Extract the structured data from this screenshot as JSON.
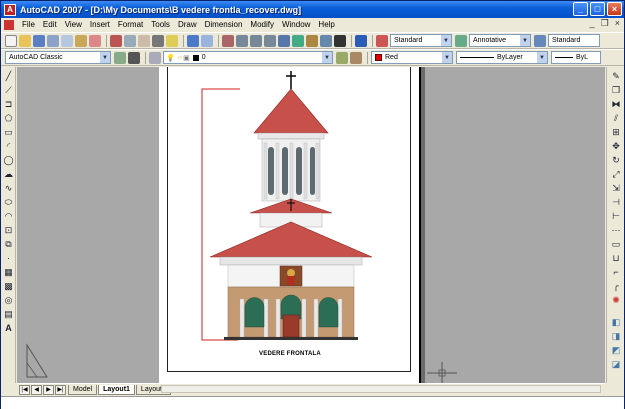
{
  "window": {
    "title": "AutoCAD 2007 - [D:\\My Documents\\B vedere frontla_recover.dwg]",
    "buttons": {
      "minimize": "_",
      "maximize": "□",
      "close": "×"
    }
  },
  "menu": {
    "items": [
      "File",
      "Edit",
      "View",
      "Insert",
      "Format",
      "Tools",
      "Draw",
      "Dimension",
      "Modify",
      "Window",
      "Help"
    ],
    "doc_controls": {
      "minimize": "_",
      "restore": "❐",
      "close": "×"
    }
  },
  "toolbar1": {
    "text_style": "Standard",
    "annotative": "Annotative",
    "table_style": "Standard"
  },
  "toolbar2": {
    "workspace": "AutoCAD Classic",
    "layer": "0",
    "color": "Red",
    "linetype": "ByLayer",
    "lineweight": "ByL"
  },
  "drawing": {
    "view_label": "VEDERE FRONTALA"
  },
  "layout_tabs": {
    "nav": [
      "|◀",
      "◀",
      "▶",
      "▶|"
    ],
    "tabs": [
      "Model",
      "Layout1",
      "Layout2"
    ],
    "active": "Layout1"
  },
  "colors": {
    "title_blue": "#0550c9",
    "roof_red": "#c8504a",
    "base_brown": "#c49a72",
    "column_white": "#f2f2f2",
    "arch_green": "#2c6e55",
    "guide_red": "#d02020"
  },
  "icons": {
    "left": [
      "line-icon",
      "construction-line-icon",
      "polyline-icon",
      "polygon-icon",
      "rectangle-icon",
      "arc-icon",
      "circle-icon",
      "revision-cloud-icon",
      "spline-icon",
      "ellipse-icon",
      "ellipse-arc-icon",
      "insert-block-icon",
      "make-block-icon",
      "point-icon",
      "hatch-icon",
      "gradient-icon",
      "region-icon",
      "table-icon",
      "multiline-text-icon"
    ],
    "right": [
      "erase-icon",
      "copy-icon",
      "mirror-icon",
      "offset-icon",
      "array-icon",
      "move-icon",
      "rotate-icon",
      "scale-icon",
      "stretch-icon",
      "trim-icon",
      "extend-icon",
      "break-at-point-icon",
      "break-icon",
      "join-icon",
      "chamfer-icon",
      "fillet-icon",
      "explode-icon"
    ]
  }
}
